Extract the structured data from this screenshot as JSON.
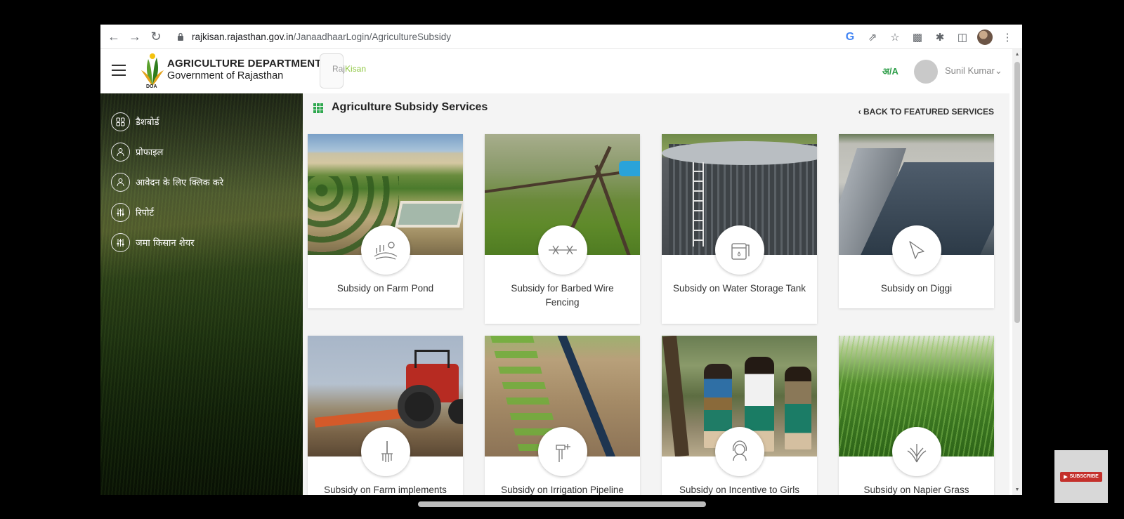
{
  "browser": {
    "url_domain": "rajkisan.rajasthan.gov.in",
    "url_path": "/JanaadhaarLogin/AgricultureSubsidy",
    "icons": [
      "back-icon",
      "forward-icon",
      "reload-icon",
      "lock-icon",
      "google-icon",
      "share-icon",
      "star-icon",
      "extension-icon",
      "puzzle-icon",
      "sidepanel-icon",
      "profile-icon",
      "menu-icon"
    ]
  },
  "header": {
    "dept_title": "AGRICULTURE DEPARTMENT",
    "dept_subtitle": "Government of Rajasthan",
    "doa_label": "DOA",
    "app_name_a": "Raj",
    "app_name_b": "Kisan",
    "lang_toggle": "अ/A",
    "user_name": "Sunil Kumar"
  },
  "sidebar": {
    "items": [
      {
        "label": "डैशबोर्ड",
        "icon": "dashboard-icon"
      },
      {
        "label": "प्रोफाइल",
        "icon": "user-icon"
      },
      {
        "label": "आवेदन के लिए क्लिक करे",
        "icon": "user-icon"
      },
      {
        "label": "रिपोर्ट",
        "icon": "sliders-icon"
      },
      {
        "label": "जमा किसान शेयर",
        "icon": "sliders-icon"
      }
    ]
  },
  "main": {
    "title": "Agriculture Subsidy Services",
    "back_link": "BACK TO FEATURED SERVICES",
    "cards": [
      {
        "label": "Subsidy on Farm Pond",
        "icon": "farm-pond-icon"
      },
      {
        "label": "Subsidy for Barbed Wire Fencing",
        "icon": "barbed-wire-icon"
      },
      {
        "label": "Subsidy on Water Storage Tank",
        "icon": "water-tank-icon"
      },
      {
        "label": "Subsidy on Diggi",
        "icon": "diggi-icon"
      },
      {
        "label": "Subsidy on Farm implements",
        "icon": "farm-implement-icon"
      },
      {
        "label": "Subsidy on Irrigation Pipeline",
        "icon": "irrigation-pipe-icon"
      },
      {
        "label": "Subsidy on Incentive to Girls",
        "icon": "girl-student-icon"
      },
      {
        "label": "Subsidy on Napier Grass",
        "icon": "grass-icon"
      }
    ]
  },
  "overlay": {
    "subscribe_label": "SUBSCRIBE"
  }
}
